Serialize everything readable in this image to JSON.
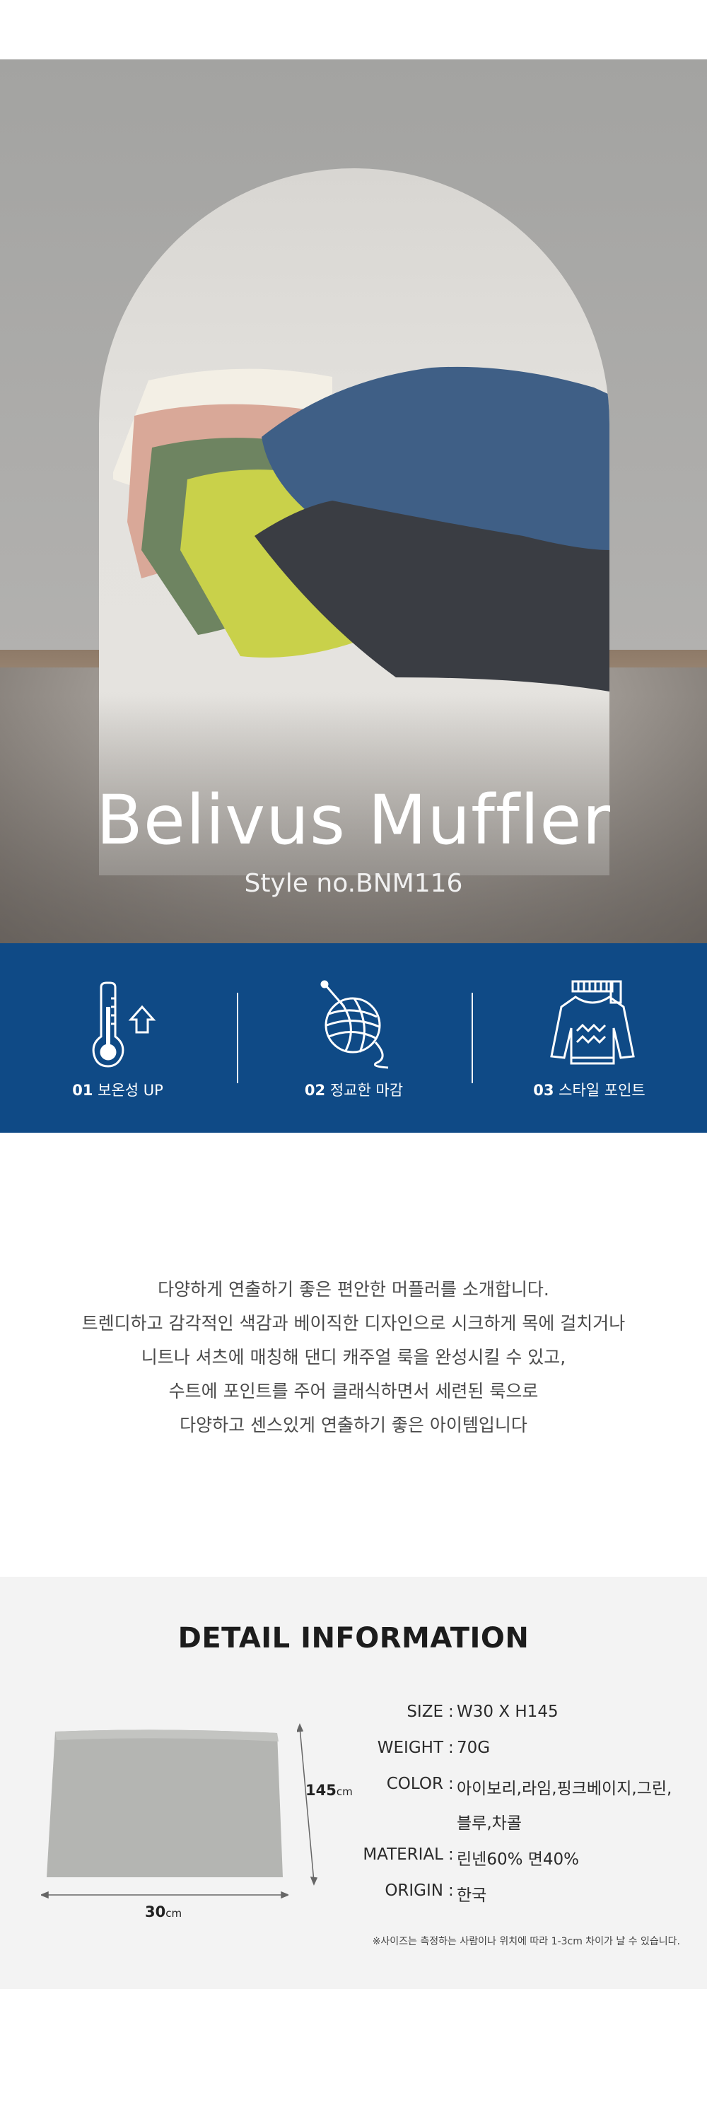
{
  "hero": {
    "title": "Belivus Muffler",
    "style_no": "Style no.BNM116"
  },
  "features": [
    {
      "num": "01",
      "label": "보온성 UP",
      "icon": "thermometer-up-icon"
    },
    {
      "num": "02",
      "label": "정교한 마감",
      "icon": "yarn-ball-icon"
    },
    {
      "num": "03",
      "label": "스타일 포인트",
      "icon": "sweater-scarf-icon"
    }
  ],
  "description": [
    "다양하게 연출하기 좋은 편안한 머플러를 소개합니다.",
    "트렌디하고 감각적인 색감과 베이직한 디자인으로 시크하게 목에 걸치거나",
    "니트나 셔츠에 매칭해 댄디 캐주얼 룩을 완성시킬 수 있고,",
    "수트에 포인트를 주어 클래식하면서 세련된 룩으로",
    "다양하고 센스있게 연출하기 좋은 아이템입니다"
  ],
  "detail": {
    "title": "DETAIL INFORMATION",
    "height_value": "145",
    "height_unit": "cm",
    "width_value": "30",
    "width_unit": "cm",
    "specs": [
      {
        "key": "SIZE",
        "value": "W30 X H145"
      },
      {
        "key": "WEIGHT",
        "value": "70G"
      },
      {
        "key": "COLOR",
        "value": "아이보리,라임,핑크베이지,그린,"
      },
      {
        "key": "",
        "value": "블루,차콜"
      },
      {
        "key": "MATERIAL",
        "value": "린넨60% 면40%"
      },
      {
        "key": "ORIGIN",
        "value": "한국"
      }
    ],
    "note": "※사이즈는 측정하는 사람이나 위치에 따라 1-3cm 차이가 날 수 있습니다."
  },
  "colors": {
    "feature_bg": "#0f4a86",
    "detail_bg": "#f3f3f3",
    "swatch": "#b4b5b2"
  }
}
